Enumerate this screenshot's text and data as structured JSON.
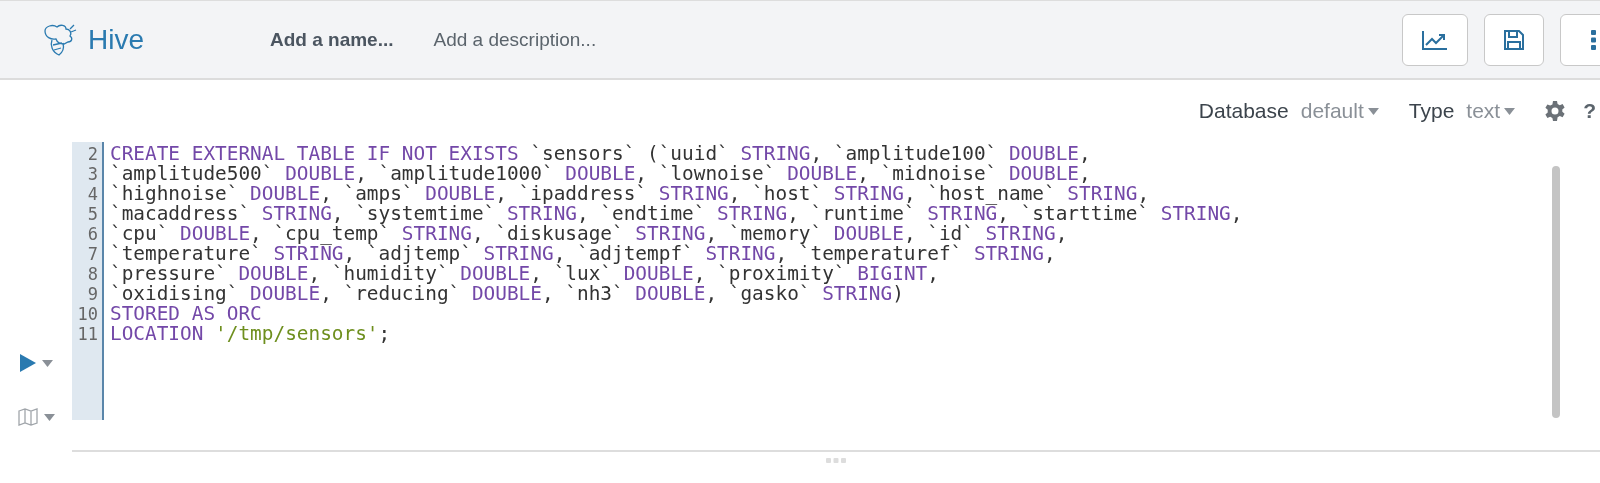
{
  "header": {
    "app_name": "Hive",
    "name_placeholder": "Add a name...",
    "description_placeholder": "Add a description..."
  },
  "settings": {
    "database_label": "Database",
    "database_value": "default",
    "type_label": "Type",
    "type_value": "text",
    "help": "?"
  },
  "editor": {
    "lines": [
      {
        "number": "2",
        "tokens": [
          {
            "kind": "keyword",
            "text": "CREATE EXTERNAL TABLE IF NOT EXISTS"
          },
          {
            "kind": "plain",
            "text": " `sensors` (`uuid` "
          },
          {
            "kind": "keyword",
            "text": "STRING"
          },
          {
            "kind": "plain",
            "text": ", `amplitude100` "
          },
          {
            "kind": "keyword",
            "text": "DOUBLE"
          },
          {
            "kind": "plain",
            "text": ","
          }
        ]
      },
      {
        "number": "3",
        "tokens": [
          {
            "kind": "plain",
            "text": "`amplitude500` "
          },
          {
            "kind": "keyword",
            "text": "DOUBLE"
          },
          {
            "kind": "plain",
            "text": ", `amplitude1000` "
          },
          {
            "kind": "keyword",
            "text": "DOUBLE"
          },
          {
            "kind": "plain",
            "text": ", `lownoise` "
          },
          {
            "kind": "keyword",
            "text": "DOUBLE"
          },
          {
            "kind": "plain",
            "text": ", `midnoise` "
          },
          {
            "kind": "keyword",
            "text": "DOUBLE"
          },
          {
            "kind": "plain",
            "text": ","
          }
        ]
      },
      {
        "number": "4",
        "tokens": [
          {
            "kind": "plain",
            "text": "`highnoise` "
          },
          {
            "kind": "keyword",
            "text": "DOUBLE"
          },
          {
            "kind": "plain",
            "text": ", `amps` "
          },
          {
            "kind": "keyword",
            "text": "DOUBLE"
          },
          {
            "kind": "plain",
            "text": ", `ipaddress` "
          },
          {
            "kind": "keyword",
            "text": "STRING"
          },
          {
            "kind": "plain",
            "text": ", `host` "
          },
          {
            "kind": "keyword",
            "text": "STRING"
          },
          {
            "kind": "plain",
            "text": ", `host_name` "
          },
          {
            "kind": "keyword",
            "text": "STRING"
          },
          {
            "kind": "plain",
            "text": ","
          }
        ]
      },
      {
        "number": "5",
        "tokens": [
          {
            "kind": "plain",
            "text": "`macaddress` "
          },
          {
            "kind": "keyword",
            "text": "STRING"
          },
          {
            "kind": "plain",
            "text": ", `systemtime` "
          },
          {
            "kind": "keyword",
            "text": "STRING"
          },
          {
            "kind": "plain",
            "text": ", `endtime` "
          },
          {
            "kind": "keyword",
            "text": "STRING"
          },
          {
            "kind": "plain",
            "text": ", `runtime` "
          },
          {
            "kind": "keyword",
            "text": "STRING"
          },
          {
            "kind": "plain",
            "text": ", `starttime` "
          },
          {
            "kind": "keyword",
            "text": "STRING"
          },
          {
            "kind": "plain",
            "text": ","
          }
        ]
      },
      {
        "number": "6",
        "tokens": [
          {
            "kind": "plain",
            "text": "`cpu` "
          },
          {
            "kind": "keyword",
            "text": "DOUBLE"
          },
          {
            "kind": "plain",
            "text": ", `cpu_temp` "
          },
          {
            "kind": "keyword",
            "text": "STRING"
          },
          {
            "kind": "plain",
            "text": ", `diskusage` "
          },
          {
            "kind": "keyword",
            "text": "STRING"
          },
          {
            "kind": "plain",
            "text": ", `memory` "
          },
          {
            "kind": "keyword",
            "text": "DOUBLE"
          },
          {
            "kind": "plain",
            "text": ", `id` "
          },
          {
            "kind": "keyword",
            "text": "STRING"
          },
          {
            "kind": "plain",
            "text": ","
          }
        ]
      },
      {
        "number": "7",
        "tokens": [
          {
            "kind": "plain",
            "text": "`temperature` "
          },
          {
            "kind": "keyword",
            "text": "STRING"
          },
          {
            "kind": "plain",
            "text": ", `adjtemp` "
          },
          {
            "kind": "keyword",
            "text": "STRING"
          },
          {
            "kind": "plain",
            "text": ", `adjtempf` "
          },
          {
            "kind": "keyword",
            "text": "STRING"
          },
          {
            "kind": "plain",
            "text": ", `temperaturef` "
          },
          {
            "kind": "keyword",
            "text": "STRING"
          },
          {
            "kind": "plain",
            "text": ","
          }
        ]
      },
      {
        "number": "8",
        "tokens": [
          {
            "kind": "plain",
            "text": "`pressure` "
          },
          {
            "kind": "keyword",
            "text": "DOUBLE"
          },
          {
            "kind": "plain",
            "text": ", `humidity` "
          },
          {
            "kind": "keyword",
            "text": "DOUBLE"
          },
          {
            "kind": "plain",
            "text": ", `lux` "
          },
          {
            "kind": "keyword",
            "text": "DOUBLE"
          },
          {
            "kind": "plain",
            "text": ", `proximity` "
          },
          {
            "kind": "keyword",
            "text": "BIGINT"
          },
          {
            "kind": "plain",
            "text": ","
          }
        ]
      },
      {
        "number": "9",
        "tokens": [
          {
            "kind": "plain",
            "text": "`oxidising` "
          },
          {
            "kind": "keyword",
            "text": "DOUBLE"
          },
          {
            "kind": "plain",
            "text": ", `reducing` "
          },
          {
            "kind": "keyword",
            "text": "DOUBLE"
          },
          {
            "kind": "plain",
            "text": ", `nh3` "
          },
          {
            "kind": "keyword",
            "text": "DOUBLE"
          },
          {
            "kind": "plain",
            "text": ", `gasko` "
          },
          {
            "kind": "keyword",
            "text": "STRING"
          },
          {
            "kind": "plain",
            "text": ")"
          }
        ]
      },
      {
        "number": "10",
        "tokens": [
          {
            "kind": "keyword",
            "text": "STORED AS ORC"
          }
        ]
      },
      {
        "number": "11",
        "tokens": [
          {
            "kind": "keyword",
            "text": "LOCATION"
          },
          {
            "kind": "string",
            "text": " '/tmp/sensors'"
          },
          {
            "kind": "plain",
            "text": ";"
          }
        ]
      }
    ]
  }
}
